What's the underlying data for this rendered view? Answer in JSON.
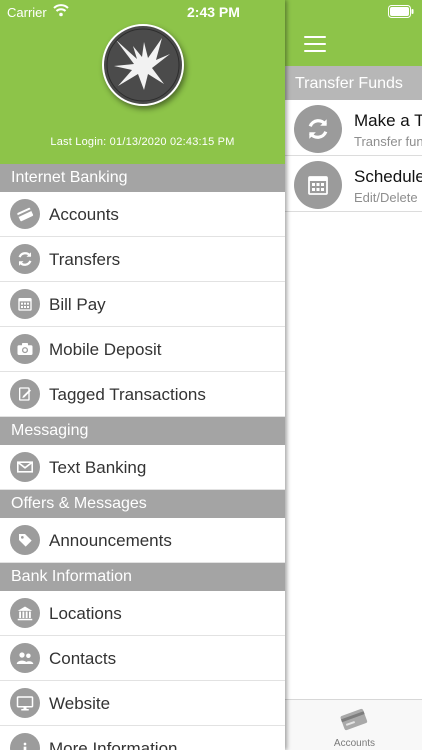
{
  "status_bar": {
    "carrier": "Carrier",
    "time": "2:43 PM"
  },
  "drawer": {
    "last_login": "Last Login: 01/13/2020 02:43:15 PM",
    "sections": [
      {
        "title": "Internet Banking",
        "items": [
          {
            "label": "Accounts",
            "icon": "credit-card-icon"
          },
          {
            "label": "Transfers",
            "icon": "refresh-icon"
          },
          {
            "label": "Bill Pay",
            "icon": "calendar-icon"
          },
          {
            "label": "Mobile Deposit",
            "icon": "camera-icon"
          },
          {
            "label": "Tagged Transactions",
            "icon": "edit-note-icon"
          }
        ]
      },
      {
        "title": "Messaging",
        "items": [
          {
            "label": "Text Banking",
            "icon": "envelope-icon"
          }
        ]
      },
      {
        "title": "Offers & Messages",
        "items": [
          {
            "label": "Announcements",
            "icon": "tag-icon"
          }
        ]
      },
      {
        "title": "Bank Information",
        "items": [
          {
            "label": "Locations",
            "icon": "bank-building-icon"
          },
          {
            "label": "Contacts",
            "icon": "people-icon"
          },
          {
            "label": "Website",
            "icon": "monitor-icon"
          },
          {
            "label": "More Information",
            "icon": "info-icon"
          }
        ]
      }
    ]
  },
  "main": {
    "section_title": "Transfer Funds",
    "rows": [
      {
        "title": "Make a T",
        "subtitle": "Transfer fun",
        "icon": "refresh-icon"
      },
      {
        "title": "Schedule",
        "subtitle": "Edit/Delete",
        "icon": "calendar-icon"
      }
    ],
    "tab_bar": {
      "accounts_label": "Accounts"
    }
  },
  "colors": {
    "brand_green": "#8dc449",
    "section_gray": "#a4a4a4",
    "icon_gray": "#9c9c9c"
  }
}
